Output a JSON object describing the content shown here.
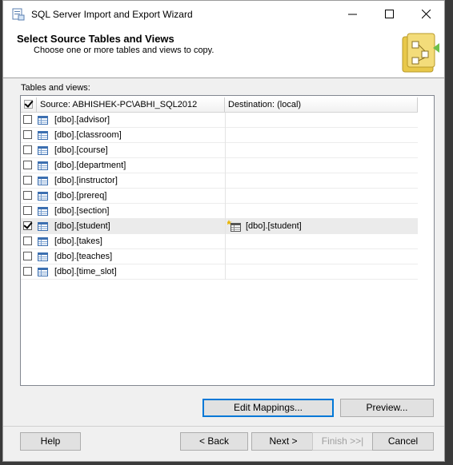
{
  "window": {
    "title": "SQL Server Import and Export Wizard"
  },
  "header": {
    "title": "Select Source Tables and Views",
    "subtitle": "Choose one or more tables and views to copy."
  },
  "grid": {
    "label": "Tables and views:",
    "columns": {
      "source": "Source: ABHISHEK-PC\\ABHI_SQL2012",
      "destination": "Destination: (local)"
    },
    "rows": [
      {
        "source": "[dbo].[advisor]",
        "checked": false,
        "destination": ""
      },
      {
        "source": "[dbo].[classroom]",
        "checked": false,
        "destination": ""
      },
      {
        "source": "[dbo].[course]",
        "checked": false,
        "destination": ""
      },
      {
        "source": "[dbo].[department]",
        "checked": false,
        "destination": ""
      },
      {
        "source": "[dbo].[instructor]",
        "checked": false,
        "destination": ""
      },
      {
        "source": "[dbo].[prereq]",
        "checked": false,
        "destination": ""
      },
      {
        "source": "[dbo].[section]",
        "checked": false,
        "destination": ""
      },
      {
        "source": "[dbo].[student]",
        "checked": true,
        "destination": "[dbo].[student]"
      },
      {
        "source": "[dbo].[takes]",
        "checked": false,
        "destination": ""
      },
      {
        "source": "[dbo].[teaches]",
        "checked": false,
        "destination": ""
      },
      {
        "source": "[dbo].[time_slot]",
        "checked": false,
        "destination": ""
      }
    ]
  },
  "buttons": {
    "edit_mappings": "Edit Mappings...",
    "preview": "Preview...",
    "help": "Help",
    "back": "< Back",
    "next": "Next >",
    "finish": "Finish >>|",
    "cancel": "Cancel"
  },
  "colors": {
    "accent": "#0078d7",
    "icon_yellow": "#e8c84a",
    "icon_green": "#6dbf4b"
  }
}
